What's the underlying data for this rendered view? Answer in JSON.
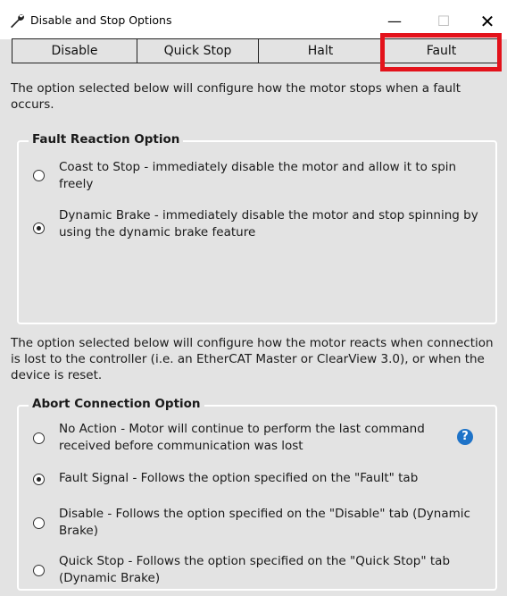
{
  "window": {
    "title": "Disable and Stop Options",
    "minimize": "—",
    "maximize": "☐",
    "close": "✕"
  },
  "tabs": [
    {
      "label": "Disable"
    },
    {
      "label": "Quick Stop"
    },
    {
      "label": "Halt"
    },
    {
      "label": "Fault"
    }
  ],
  "selected_tab": "Fault",
  "accent_color": "#e3121b",
  "fault": {
    "description": "The option selected below will configure how the motor stops when a fault occurs.",
    "group_title": "Fault Reaction Option",
    "options": [
      {
        "label": "Coast to Stop - immediately disable the motor and allow it to spin freely",
        "checked": false
      },
      {
        "label": "Dynamic Brake - immediately disable the motor and stop spinning by using the dynamic brake feature",
        "checked": true
      }
    ]
  },
  "abort": {
    "description": "The option selected below will configure how the motor reacts when connection is lost to the controller (i.e. an EtherCAT Master or ClearView 3.0), or when the device is reset.",
    "group_title": "Abort Connection Option",
    "options": [
      {
        "label": "No Action - Motor will continue to perform the last command received before communication was lost",
        "checked": false
      },
      {
        "label": "Fault Signal - Follows the option specified on the \"Fault\" tab",
        "checked": true
      },
      {
        "label": "Disable - Follows the option specified on the \"Disable\" tab (Dynamic Brake)",
        "checked": false
      },
      {
        "label": "Quick Stop - Follows the option specified on the \"Quick Stop\" tab (Dynamic Brake)",
        "checked": false
      }
    ],
    "help_icon": "question-circle-icon",
    "help_glyph": "?"
  }
}
